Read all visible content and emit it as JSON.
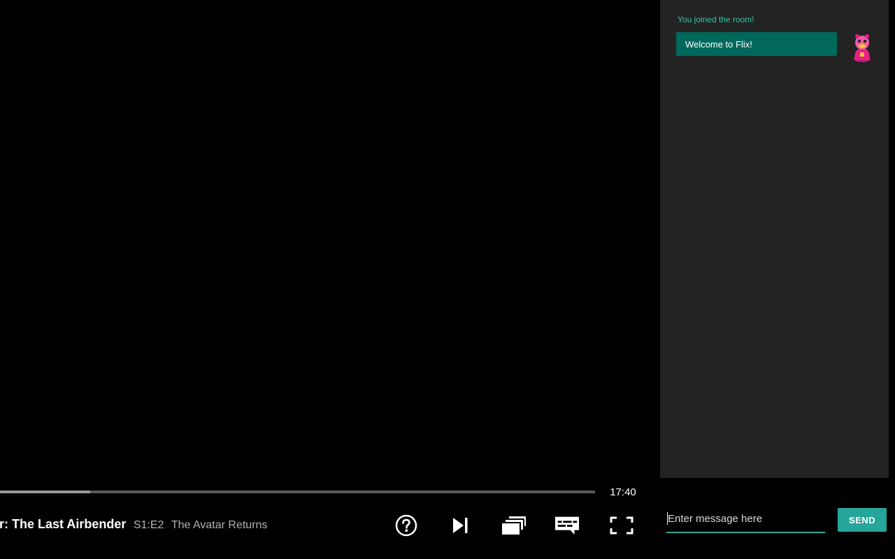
{
  "player": {
    "show_title": "tar: The Last Airbender",
    "episode_number": "S1:E2",
    "episode_title": "The Avatar Returns",
    "time_remaining": "17:40",
    "progress_fraction": 0.152
  },
  "controls": [
    {
      "name": "help-icon"
    },
    {
      "name": "next-episode-icon"
    },
    {
      "name": "episodes-icon"
    },
    {
      "name": "subtitles-icon"
    },
    {
      "name": "fullscreen-icon"
    }
  ],
  "chat": {
    "system_message": "You joined the room!",
    "messages": [
      {
        "text": "Welcome to Flix!",
        "avatar": "pink-character-avatar"
      }
    ],
    "input_placeholder": "Enter message here",
    "input_value": "",
    "send_label": "SEND"
  },
  "colors": {
    "accent": "#26a69a",
    "bubble": "#00695c",
    "system_text": "#2ec4a9",
    "panel_bg": "#232323"
  }
}
